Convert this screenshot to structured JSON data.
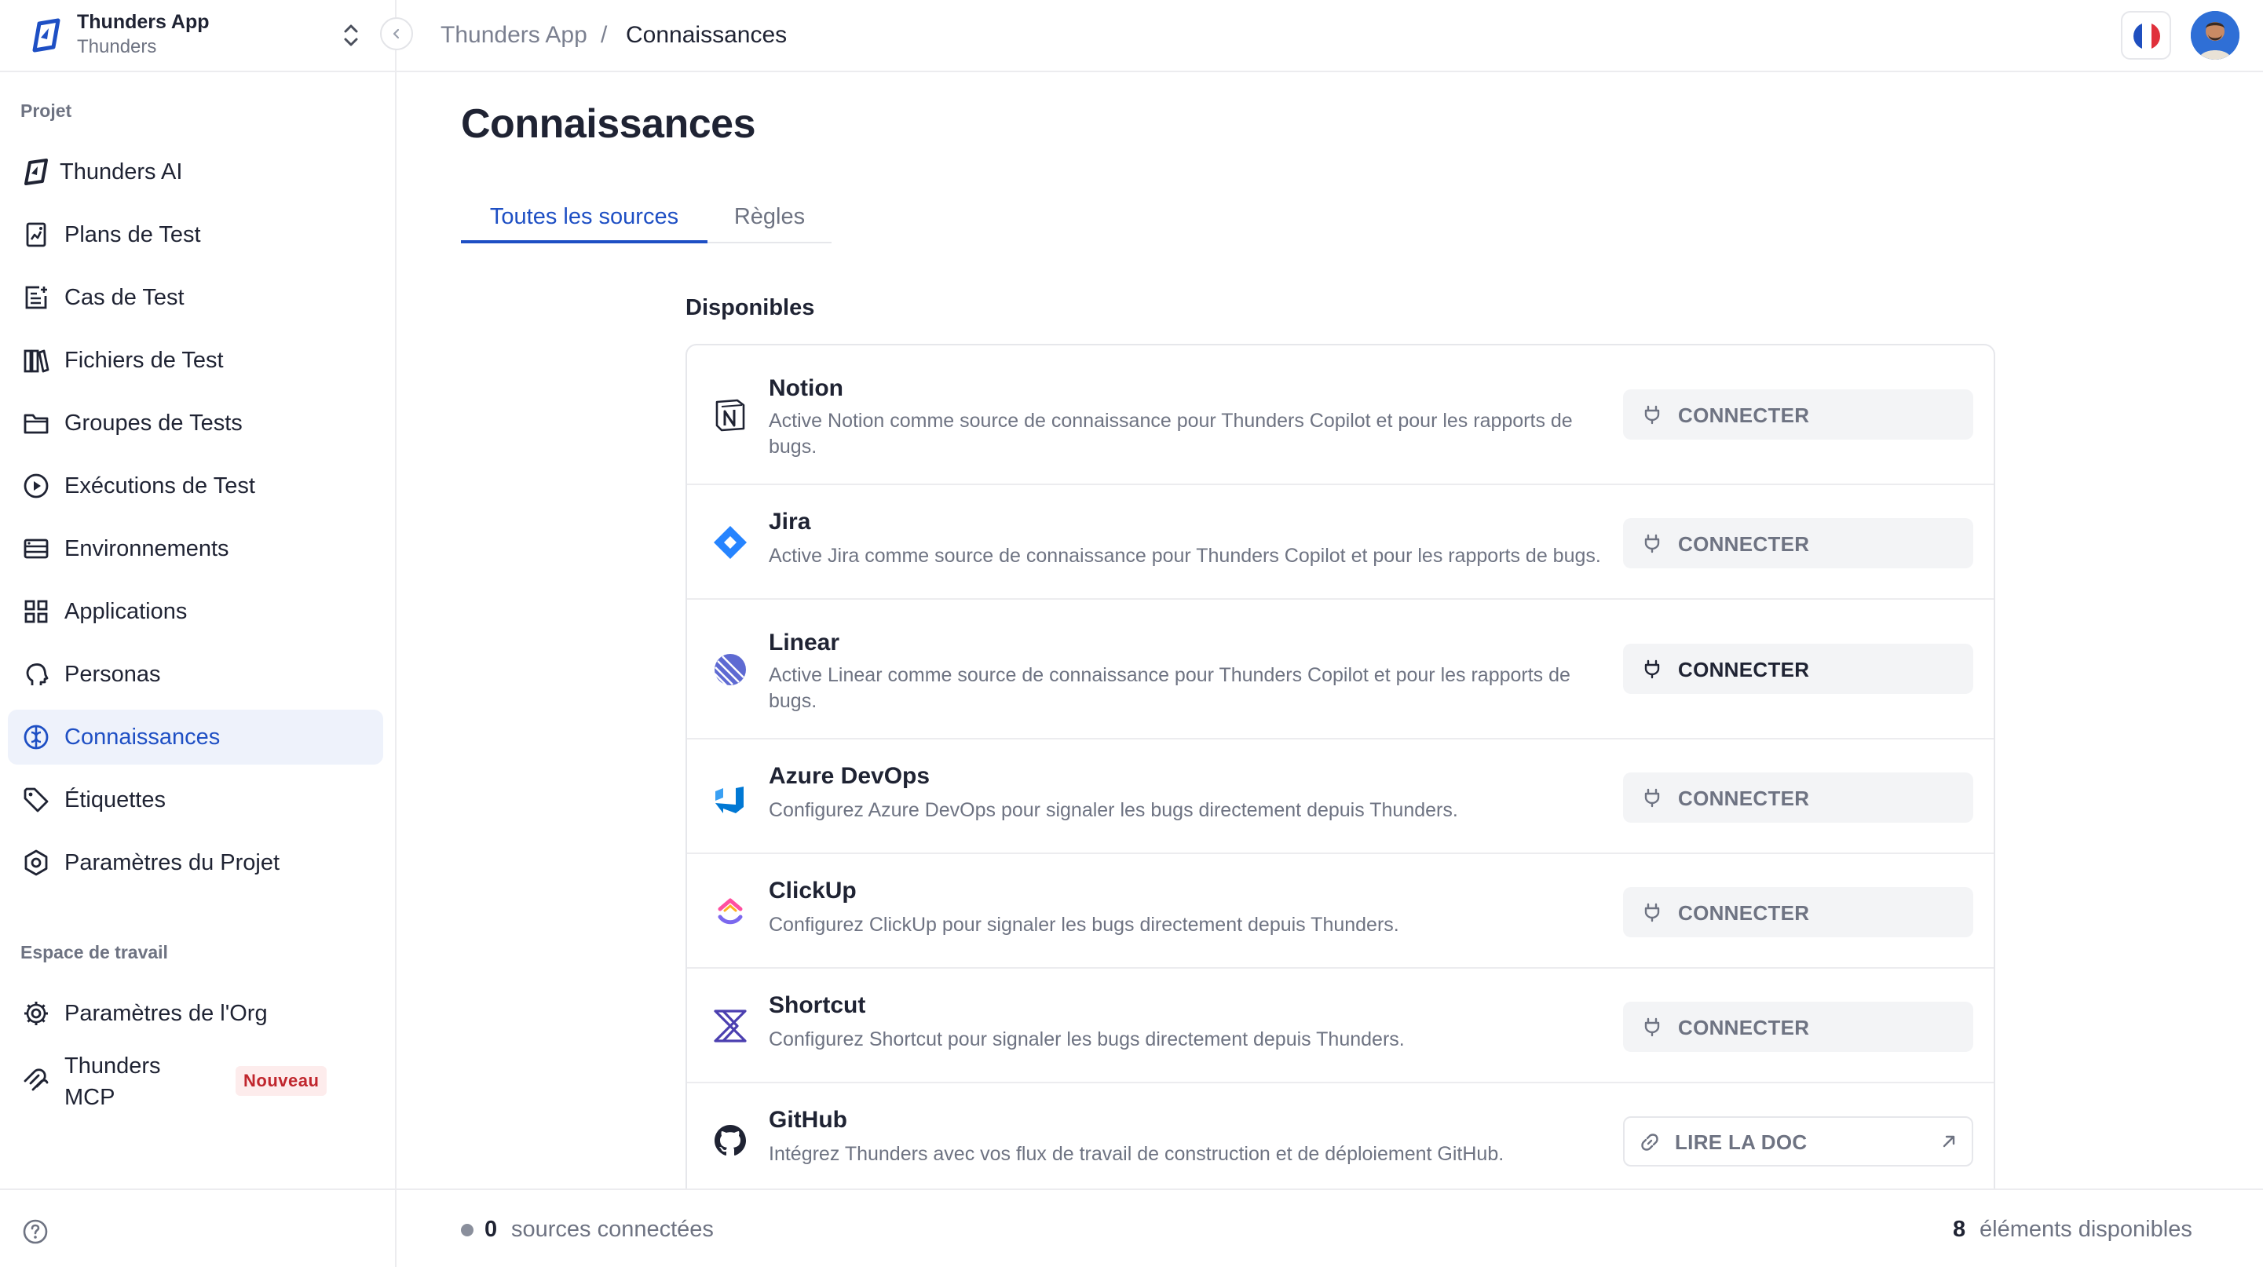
{
  "app": {
    "org_name": "Thunders App",
    "org_sub": "Thunders"
  },
  "breadcrumb": {
    "parent": "Thunders App",
    "separator": "/",
    "current": "Connaissances"
  },
  "sidebar": {
    "project_section": "Projet",
    "project_items": [
      {
        "label": "Thunders AI",
        "icon": "thunders-logo-icon"
      },
      {
        "label": "Plans de Test",
        "icon": "test-plan-icon"
      },
      {
        "label": "Cas de Test",
        "icon": "test-case-icon"
      },
      {
        "label": "Fichiers de Test",
        "icon": "test-files-icon"
      },
      {
        "label": "Groupes de Tests",
        "icon": "folder-icon"
      },
      {
        "label": "Exécutions de Test",
        "icon": "play-circle-icon"
      },
      {
        "label": "Environnements",
        "icon": "server-icon"
      },
      {
        "label": "Applications",
        "icon": "apps-grid-icon"
      },
      {
        "label": "Personas",
        "icon": "head-icon"
      },
      {
        "label": "Connaissances",
        "icon": "knowledge-icon",
        "active": true
      },
      {
        "label": "Étiquettes",
        "icon": "tag-icon"
      },
      {
        "label": "Paramètres du Projet",
        "icon": "hexagon-settings-icon"
      }
    ],
    "workspace_section": "Espace de travail",
    "workspace_items": [
      {
        "label": "Paramètres de l'Org",
        "icon": "gear-icon"
      },
      {
        "label": "Thunders MCP",
        "icon": "mcp-icon",
        "badge": "Nouveau"
      }
    ]
  },
  "page": {
    "title": "Connaissances",
    "tabs": [
      {
        "label": "Toutes les sources",
        "active": true
      },
      {
        "label": "Règles",
        "active": false
      }
    ],
    "section_title": "Disponibles"
  },
  "sources": [
    {
      "name": "Notion",
      "description": "Active Notion comme source de connaissance pour Thunders Copilot et pour les rapports de bugs.",
      "action": "CONNECTER",
      "icon": "notion-icon"
    },
    {
      "name": "Jira",
      "description": "Active Jira comme source de connaissance pour Thunders Copilot et pour les rapports de bugs.",
      "action": "CONNECTER",
      "icon": "jira-icon"
    },
    {
      "name": "Linear",
      "description": "Active Linear comme source de connaissance pour Thunders Copilot et pour les rapports de bugs.",
      "action": "CONNECTER",
      "icon": "linear-icon"
    },
    {
      "name": "Azure DevOps",
      "description": "Configurez Azure DevOps pour signaler les bugs directement depuis Thunders.",
      "action": "CONNECTER",
      "icon": "azure-devops-icon"
    },
    {
      "name": "ClickUp",
      "description": "Configurez ClickUp pour signaler les bugs directement depuis Thunders.",
      "action": "CONNECTER",
      "icon": "clickup-icon"
    },
    {
      "name": "Shortcut",
      "description": "Configurez Shortcut pour signaler les bugs directement depuis Thunders.",
      "action": "CONNECTER",
      "icon": "shortcut-icon"
    },
    {
      "name": "GitHub",
      "description": "Intégrez Thunders avec vos flux de travail de construction et de déploiement GitHub.",
      "action": "LIRE LA DOC",
      "icon": "github-icon"
    }
  ],
  "footer": {
    "connected_count": "0",
    "connected_label": "sources connectées",
    "available_count": "8",
    "available_label": "éléments disponibles"
  },
  "colors": {
    "accent": "#1e4fc4",
    "active_bg": "#eef2fb",
    "badge_bg": "#fdecec",
    "badge_text": "#c0262d"
  }
}
